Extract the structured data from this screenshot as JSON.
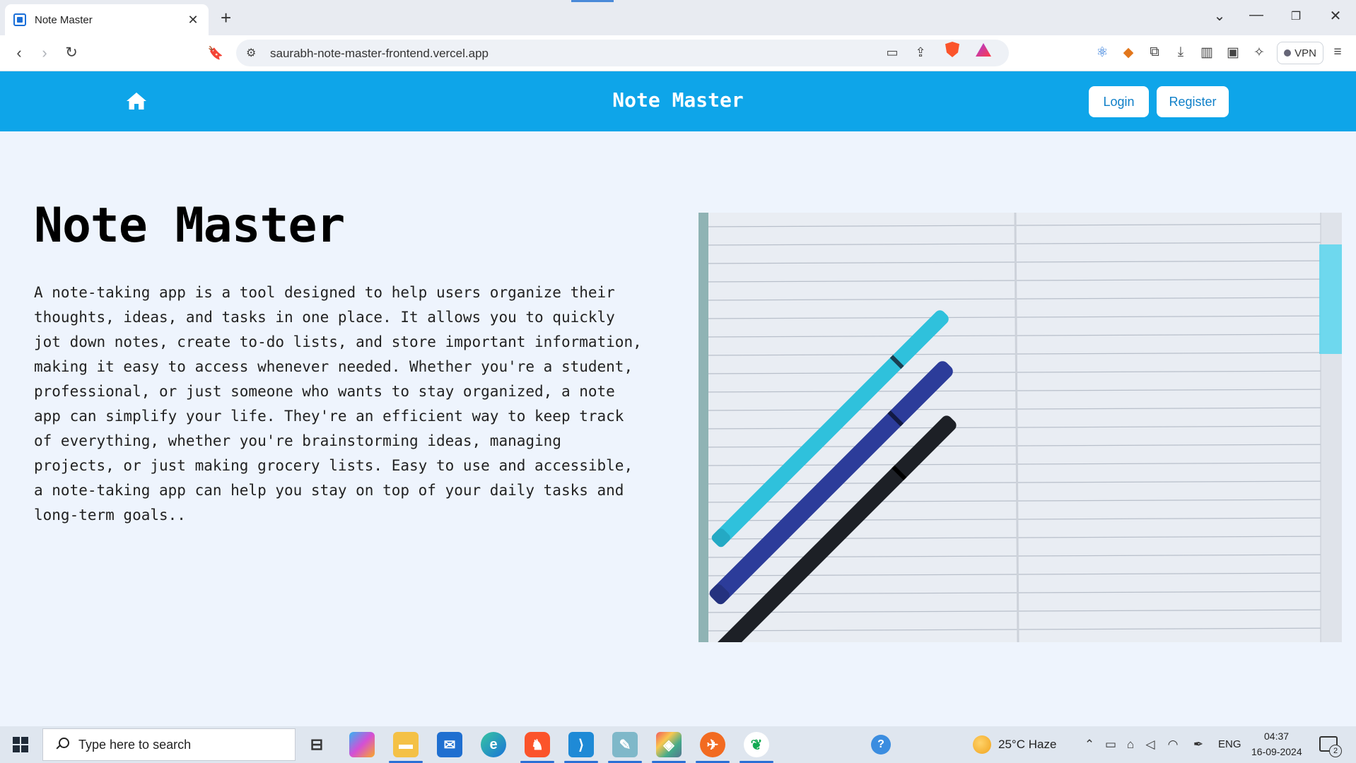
{
  "browser": {
    "tab_title": "Note Master",
    "url": "saurabh-note-master-frontend.vercel.app",
    "vpn_label": "VPN"
  },
  "navbar": {
    "brand": "Note Master",
    "login_label": "Login",
    "register_label": "Register",
    "accent_color": "#0ea5e9"
  },
  "hero": {
    "title": "Note Master",
    "description": "A note-taking app is a tool designed to help users organize their thoughts, ideas, and tasks in one place. It allows you to quickly jot down notes, create to-do lists, and store important information, making it easy to access whenever needed. Whether you're a student, professional, or just someone who wants to stay organized, a note app can simplify your life. They're an efficient way to keep track of everything, whether you're brainstorming ideas, managing projects, or just making grocery lists. Easy to use and accessible, a note-taking app can help you stay on top of your daily tasks and long-term goals.."
  },
  "taskbar": {
    "search_placeholder": "Type here to search",
    "weather": "25°C  Haze",
    "language": "ENG",
    "time": "04:37",
    "date": "16-09-2024",
    "notification_count": "2"
  }
}
